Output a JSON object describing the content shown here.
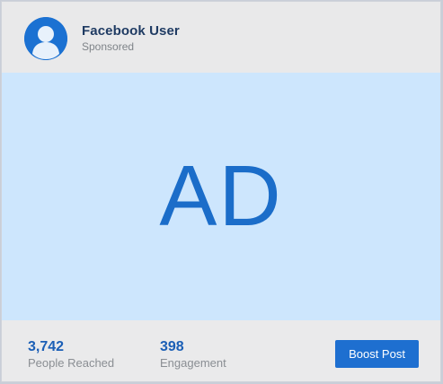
{
  "post": {
    "author": "Facebook User",
    "label": "Sponsored",
    "avatar_icon": "user-avatar-icon",
    "media_text": "AD"
  },
  "stats": {
    "reach_value": "3,742",
    "reach_label": "People Reached",
    "engagement_value": "398",
    "engagement_label": "Engagement"
  },
  "actions": {
    "boost_label": "Boost Post"
  },
  "colors": {
    "accent": "#1e6fd0",
    "media_bg": "#cde6fd",
    "card_bg": "#e9e9ea"
  }
}
